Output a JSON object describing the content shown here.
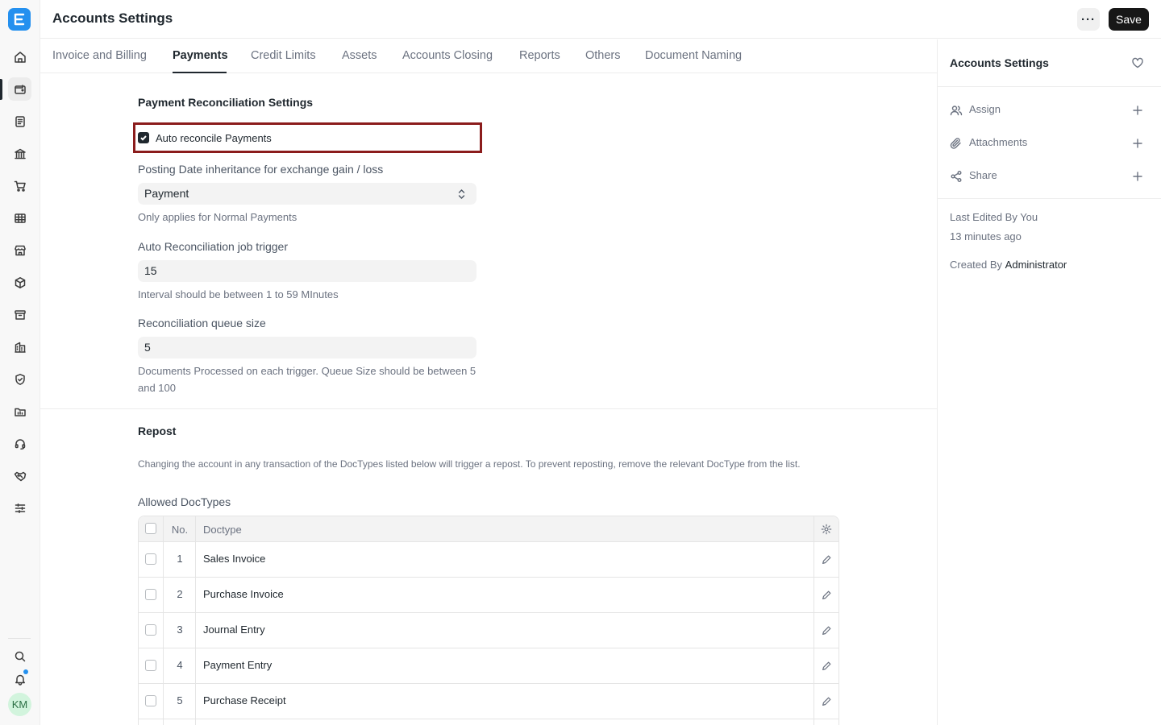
{
  "app": {
    "logo_letter": "E"
  },
  "header": {
    "title": "Accounts Settings",
    "more_label": "···",
    "save_label": "Save"
  },
  "rail": {
    "items": [
      "home-icon",
      "wallet-icon",
      "file-text-icon",
      "bank-icon",
      "cart-icon",
      "table-icon",
      "store-icon",
      "package-icon",
      "archive-icon",
      "building-icon",
      "shield-icon",
      "folder-chart-icon",
      "headset-icon",
      "handshake-icon",
      "sliders-icon"
    ],
    "active_index": 1,
    "bottom": [
      "search-icon",
      "bell-icon"
    ],
    "avatar_initials": "KM"
  },
  "tabs": [
    {
      "label": "Invoice and Billing"
    },
    {
      "label": "Payments",
      "active": true
    },
    {
      "label": "Credit Limits"
    },
    {
      "label": "Assets"
    },
    {
      "label": "Accounts Closing"
    },
    {
      "label": "Reports"
    },
    {
      "label": "Others"
    },
    {
      "label": "Document Naming"
    }
  ],
  "payments": {
    "section_title": "Payment Reconciliation Settings",
    "auto_reconcile": {
      "label": "Auto reconcile Payments",
      "checked": true
    },
    "posting_date": {
      "label": "Posting Date inheritance for exchange gain / loss",
      "value": "Payment",
      "help": "Only applies for Normal Payments"
    },
    "job_trigger": {
      "label": "Auto Reconciliation job trigger",
      "value": "15",
      "help": "Interval should be between 1 to 59 MInutes"
    },
    "queue_size": {
      "label": "Reconciliation queue size",
      "value": "5",
      "help": "Documents Processed on each trigger. Queue Size should be between 5 and 100"
    }
  },
  "repost": {
    "section_title": "Repost",
    "description": "Changing the account in any transaction of the DocTypes listed below will trigger a repost. To prevent reposting, remove the relevant DocType from the list.",
    "table_label": "Allowed DocTypes",
    "columns": {
      "no": "No.",
      "doctype": "Doctype"
    },
    "rows": [
      {
        "no": "1",
        "doctype": "Sales Invoice"
      },
      {
        "no": "2",
        "doctype": "Purchase Invoice"
      },
      {
        "no": "3",
        "doctype": "Journal Entry"
      },
      {
        "no": "4",
        "doctype": "Payment Entry"
      },
      {
        "no": "5",
        "doctype": "Purchase Receipt"
      }
    ]
  },
  "sidebar": {
    "title": "Accounts Settings",
    "actions": [
      {
        "label": "Assign",
        "icon": "users-icon"
      },
      {
        "label": "Attachments",
        "icon": "paperclip-icon"
      },
      {
        "label": "Share",
        "icon": "share-icon"
      }
    ],
    "last_edited": "Last Edited By You",
    "last_edited_time": "13 minutes ago",
    "created_by_label": "Created By",
    "created_by_value": "Administrator"
  }
}
